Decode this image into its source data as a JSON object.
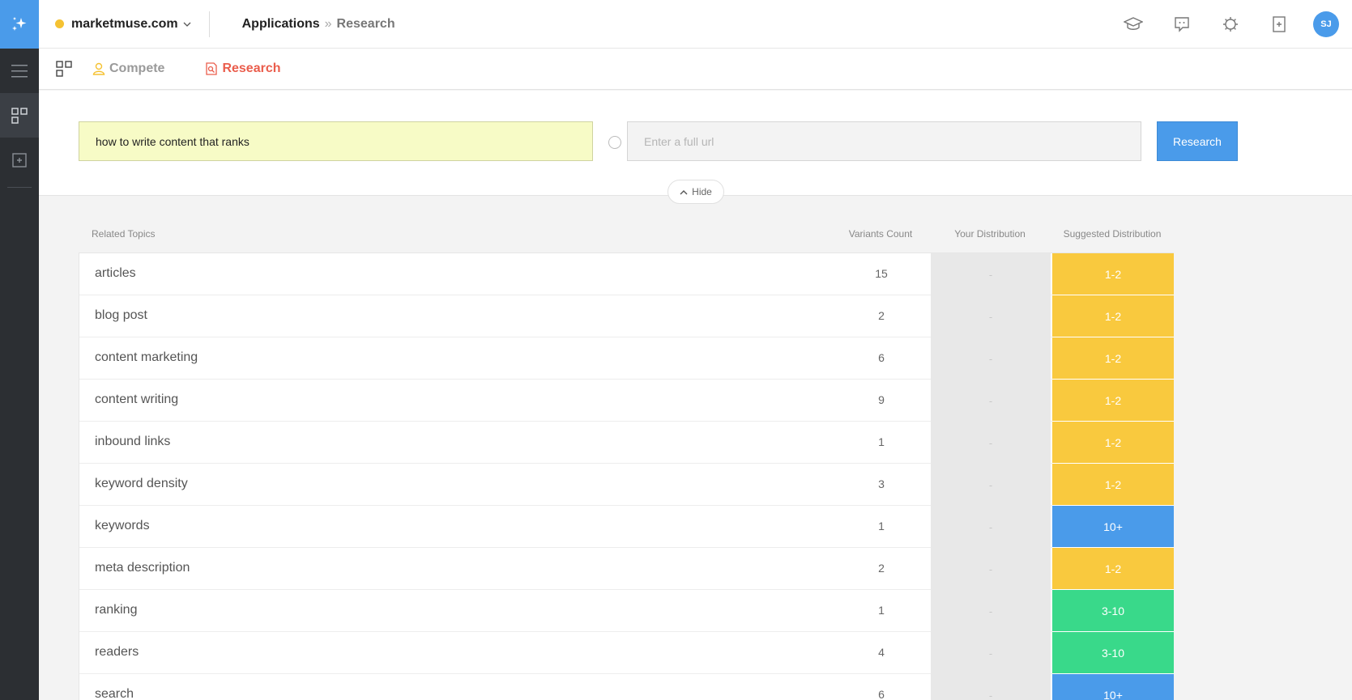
{
  "header": {
    "site_name": "marketmuse.com",
    "breadcrumb_app": "Applications",
    "breadcrumb_sep": "»",
    "breadcrumb_page": "Research",
    "avatar_initials": "SJ"
  },
  "tabs": [
    {
      "label": "Compete"
    },
    {
      "label": "Research"
    }
  ],
  "search": {
    "keyword_value": "how to write content that ranks",
    "url_placeholder": "Enter a full url",
    "research_label": "Research",
    "hide_label": "Hide"
  },
  "table": {
    "columns": {
      "topics": "Related Topics",
      "variants": "Variants Count",
      "yours": "Your Distribution",
      "suggested": "Suggested Distribution"
    },
    "rows": [
      {
        "topic": "articles",
        "count": "15",
        "yours": "-",
        "suggested": "1-2",
        "color": "yellow"
      },
      {
        "topic": "blog post",
        "count": "2",
        "yours": "-",
        "suggested": "1-2",
        "color": "yellow"
      },
      {
        "topic": "content marketing",
        "count": "6",
        "yours": "-",
        "suggested": "1-2",
        "color": "yellow"
      },
      {
        "topic": "content writing",
        "count": "9",
        "yours": "-",
        "suggested": "1-2",
        "color": "yellow"
      },
      {
        "topic": "inbound links",
        "count": "1",
        "yours": "-",
        "suggested": "1-2",
        "color": "yellow"
      },
      {
        "topic": "keyword density",
        "count": "3",
        "yours": "-",
        "suggested": "1-2",
        "color": "yellow"
      },
      {
        "topic": "keywords",
        "count": "1",
        "yours": "-",
        "suggested": "10+",
        "color": "blue"
      },
      {
        "topic": "meta description",
        "count": "2",
        "yours": "-",
        "suggested": "1-2",
        "color": "yellow"
      },
      {
        "topic": "ranking",
        "count": "1",
        "yours": "-",
        "suggested": "3-10",
        "color": "green"
      },
      {
        "topic": "readers",
        "count": "4",
        "yours": "-",
        "suggested": "3-10",
        "color": "green"
      },
      {
        "topic": "search",
        "count": "6",
        "yours": "-",
        "suggested": "10+",
        "color": "blue"
      }
    ]
  },
  "colors": {
    "accent_blue": "#4a9bea",
    "yellow": "#f9c93e",
    "green": "#39d98a",
    "research_red": "#ea5d4c"
  }
}
